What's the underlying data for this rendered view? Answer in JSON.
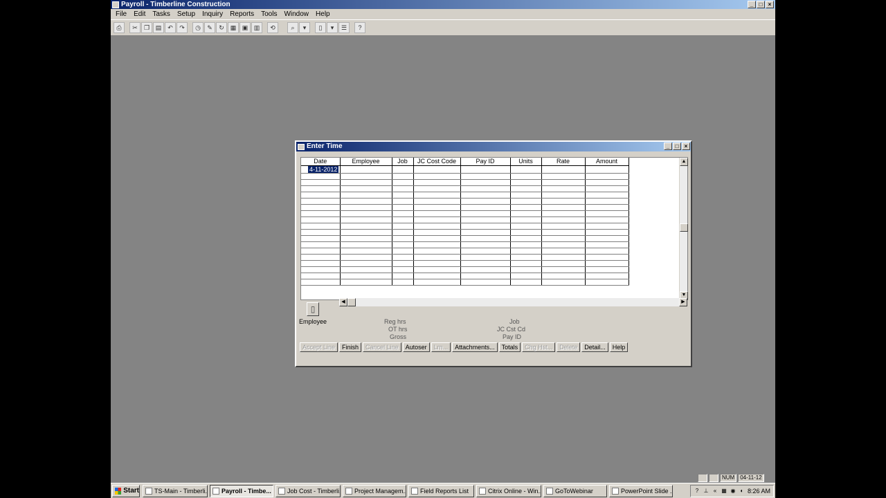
{
  "app": {
    "title": "Payroll - Timberline Construction",
    "window_controls": [
      "_",
      "□",
      "×"
    ]
  },
  "menu": [
    "File",
    "Edit",
    "Tasks",
    "Setup",
    "Inquiry",
    "Reports",
    "Tools",
    "Window",
    "Help"
  ],
  "toolbar_icons": [
    "print-icon",
    "cut-icon",
    "copy-icon",
    "paste-icon",
    "undo-icon",
    "redo-icon",
    "clock-icon",
    "edit-icon",
    "refresh-icon",
    "calendar-icon",
    "post-icon",
    "report-icon",
    "sync-icon",
    "zoom-icon",
    "page-icon",
    "list-icon",
    "context-help-icon"
  ],
  "dialog": {
    "title": "Enter Time",
    "columns": [
      "Date",
      "Employee",
      "Job",
      "JC Cost Code",
      "Pay ID",
      "Units",
      "Rate",
      "Amount"
    ],
    "first_row_date": "4-11-2012",
    "employee_label": "Employee",
    "info_left": [
      "Reg hrs",
      "OT hrs",
      "Gross"
    ],
    "info_right": [
      "Job",
      "JC Cst Cd",
      "Pay ID"
    ],
    "buttons": [
      {
        "label": "Accept Line",
        "disabled": true
      },
      {
        "label": "Finish",
        "disabled": false
      },
      {
        "label": "Cancel Line",
        "disabled": true
      },
      {
        "label": "Autoser",
        "disabled": false
      },
      {
        "label": "Lrn...",
        "disabled": true
      },
      {
        "label": "Attachments...",
        "disabled": false
      },
      {
        "label": "Totals",
        "disabled": false
      },
      {
        "label": "Chg Hst...",
        "disabled": true
      },
      {
        "label": "Delete",
        "disabled": true
      },
      {
        "label": "Detail...",
        "disabled": false
      },
      {
        "label": "Help",
        "disabled": false
      }
    ]
  },
  "status": {
    "num": "NUM",
    "date": "04-11-12"
  },
  "taskbar": {
    "start_label": "Start",
    "tasks": [
      {
        "label": "TS-Main - Timberli...",
        "active": false
      },
      {
        "label": "Payroll - Timbe...",
        "active": true
      },
      {
        "label": "Job Cost - Timberli...",
        "active": false
      },
      {
        "label": "Project Managem...",
        "active": false
      },
      {
        "label": "Field Reports List",
        "active": false
      },
      {
        "label": "Citrix Online - Win...",
        "active": false
      },
      {
        "label": "GoToWebinar",
        "active": false
      },
      {
        "label": "PowerPoint Slide ...",
        "active": false
      }
    ],
    "clock": "8:26 AM"
  }
}
